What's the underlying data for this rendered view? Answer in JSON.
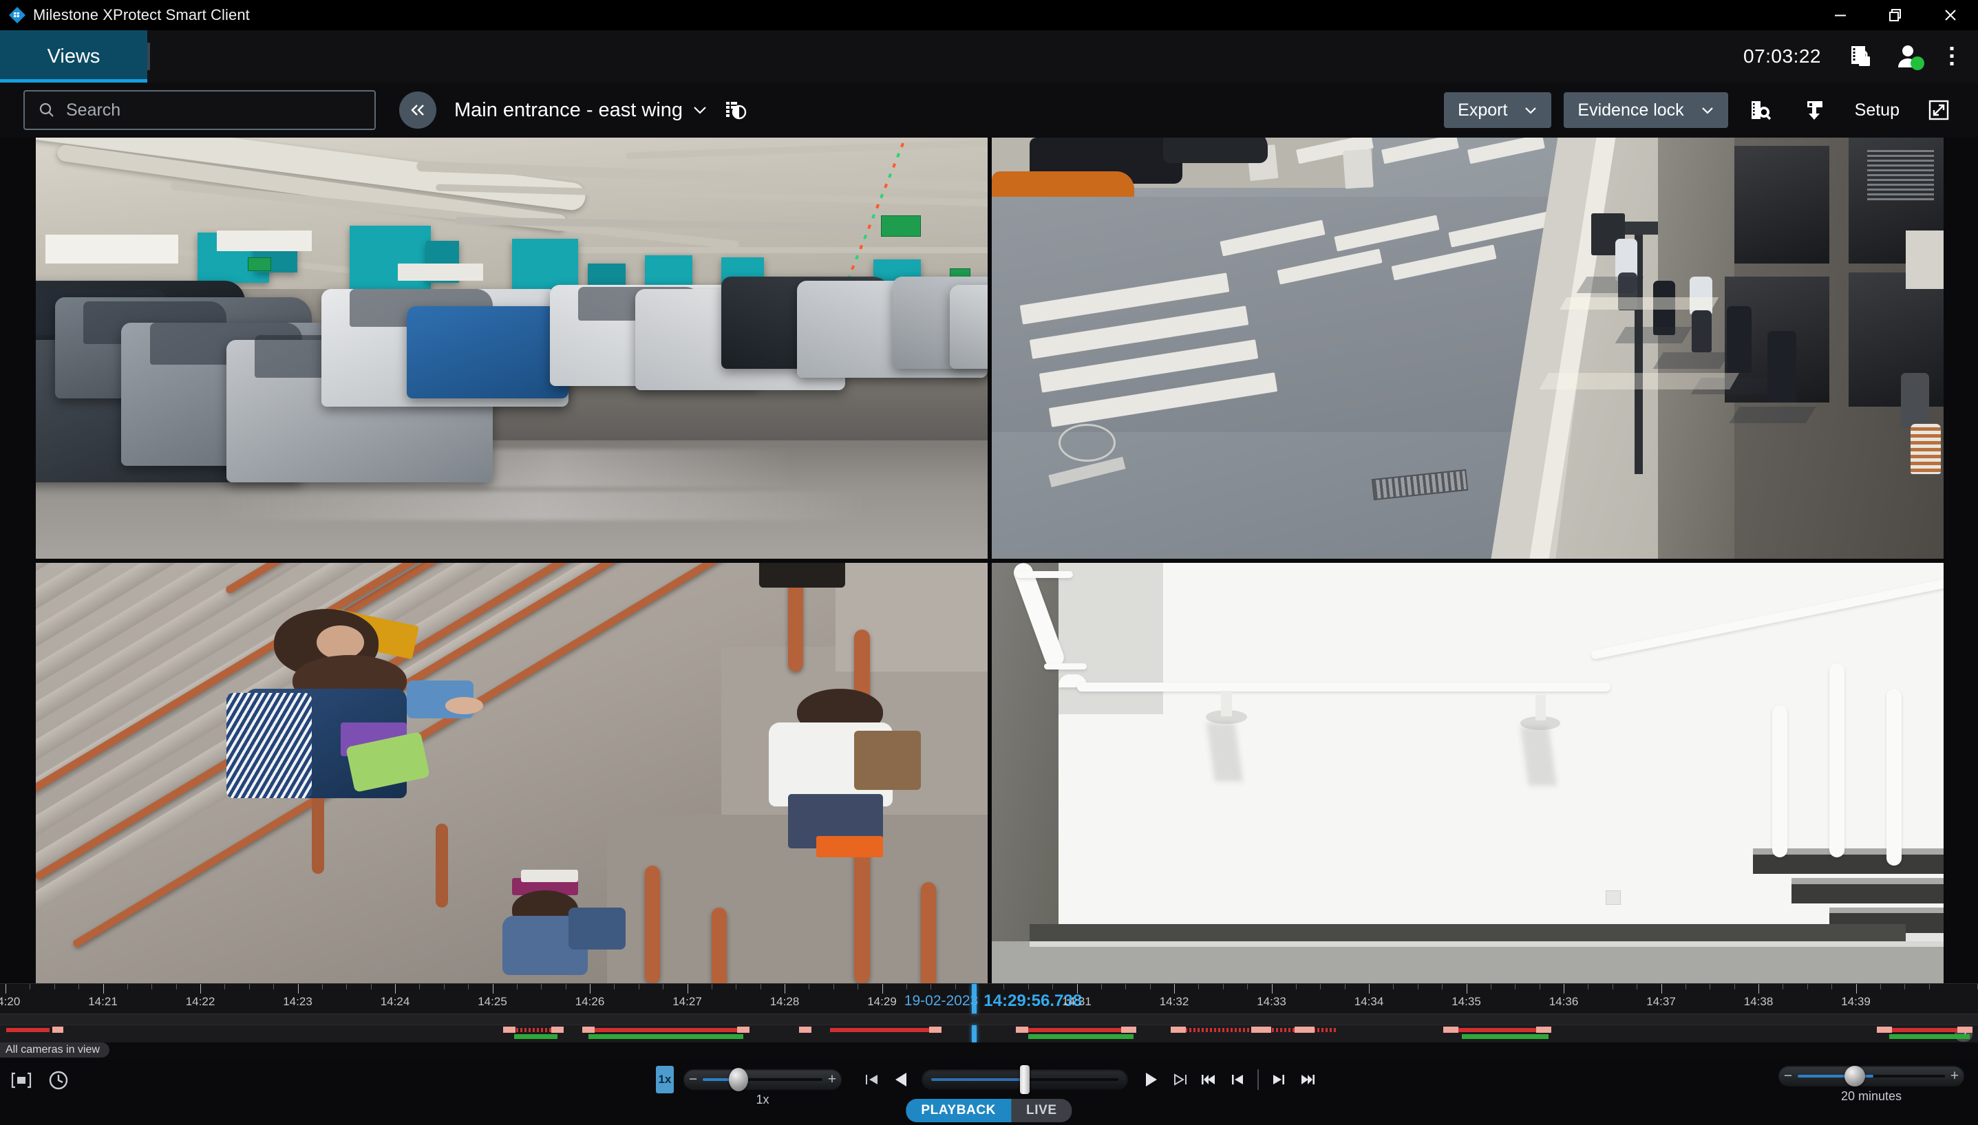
{
  "window": {
    "title": "Milestone XProtect Smart Client",
    "minimize_label": "Minimize",
    "restore_label": "Restore",
    "close_label": "Close"
  },
  "header": {
    "tab_label": "Views",
    "clock": "07:03:22",
    "evidence_lock_icon": "film-lock-icon",
    "user_icon": "user-avatar-icon",
    "user_status": "online",
    "status_color": "#22c03c",
    "menu_icon": "kebab-menu-icon"
  },
  "toolbar": {
    "search_placeholder": "Search",
    "search_value": "",
    "collapse_label": "«",
    "view_title": "Main entrance - east wing",
    "view_caret": "∨",
    "view_grid_icon": "view-layout-icon",
    "export_label": "Export",
    "export_caret": "∨",
    "evidence_lock_label": "Evidence lock",
    "evidence_lock_caret": "∨",
    "search_video_icon": "video-search-icon",
    "snapshot_icon": "download-snapshot-icon",
    "setup_label": "Setup",
    "fullscreen_icon": "fullscreen-expand-icon"
  },
  "grid": {
    "layout": "2x2",
    "panes": [
      {
        "name": "parking-garage-camera",
        "description": "Indoor parking garage with rows of parked cars and teal signage panels"
      },
      {
        "name": "street-crosswalk-camera",
        "description": "Street corner with crosswalk, cars and pedestrians on sidewalk"
      },
      {
        "name": "stairwell-people-camera",
        "description": "Overhead view of stairwell with copper railings and people walking"
      },
      {
        "name": "white-stairwell-camera",
        "description": "White stairwell with handrail and dark steps"
      }
    ]
  },
  "timeline": {
    "date": "19-02-2023",
    "current_time": "14:29:56.738",
    "camera_tab": "All cameras in view",
    "help_label": "?",
    "span_minutes": 20,
    "ticks": [
      "14:20",
      "14:21",
      "14:22",
      "14:23",
      "14:24",
      "14:25",
      "14:26",
      "14:27",
      "14:28",
      "14:29",
      "14:31",
      "14:32",
      "14:33",
      "14:34",
      "14:35",
      "14:36",
      "14:37",
      "14:38",
      "14:39"
    ],
    "playhead_percent": 50.0,
    "segments": [
      {
        "start": 0.5,
        "width": 3.5,
        "type": "recording"
      },
      {
        "start": 4.2,
        "width": 0.9,
        "type": "motion"
      },
      {
        "start": 41.0,
        "width": 4.0,
        "type": "recording"
      },
      {
        "start": 40.6,
        "width": 1.0,
        "type": "motion"
      },
      {
        "start": 44.5,
        "width": 1.0,
        "type": "motion"
      },
      {
        "start": 47.5,
        "width": 13.0,
        "type": "recording"
      },
      {
        "start": 47.0,
        "width": 1.0,
        "type": "motion"
      },
      {
        "start": 59.5,
        "width": 1.0,
        "type": "motion"
      },
      {
        "start": 64.5,
        "width": 1.0,
        "type": "motion"
      },
      {
        "start": 67.0,
        "width": 9.0,
        "type": "recording"
      },
      {
        "start": 75.0,
        "width": 1.0,
        "type": "motion"
      },
      {
        "start": 82.5,
        "width": 9.0,
        "type": "recording"
      },
      {
        "start": 82.0,
        "width": 1.0,
        "type": "motion"
      },
      {
        "start": 90.5,
        "width": 1.2,
        "type": "motion"
      },
      {
        "start": 95.0,
        "width": 13.0,
        "type": "recording"
      },
      {
        "start": 94.5,
        "width": 1.2,
        "type": "motion"
      },
      {
        "start": 101.0,
        "width": 1.6,
        "type": "motion"
      },
      {
        "start": 104.5,
        "width": 1.6,
        "type": "motion"
      },
      {
        "start": 117.0,
        "width": 8.0,
        "type": "recording"
      },
      {
        "start": 116.5,
        "width": 1.2,
        "type": "motion"
      },
      {
        "start": 124.0,
        "width": 1.2,
        "type": "motion"
      },
      {
        "start": 152.0,
        "width": 7.0,
        "type": "recording"
      },
      {
        "start": 151.5,
        "width": 1.2,
        "type": "motion"
      },
      {
        "start": 158.0,
        "width": 1.2,
        "type": "motion"
      }
    ],
    "audio_segments": [
      {
        "start": 41.5,
        "width": 3.5
      },
      {
        "start": 47.5,
        "width": 12.5
      },
      {
        "start": 83.0,
        "width": 8.5
      },
      {
        "start": 118.0,
        "width": 7.0
      },
      {
        "start": 152.5,
        "width": 6.5
      }
    ]
  },
  "controls": {
    "bookmark_icon": "bookmark-bracket-icon",
    "time_icon": "clock-icon",
    "speed_badge": "1x",
    "speed_label": "1x",
    "speed_minus": "−",
    "speed_plus": "+",
    "step_back_icon": "step-back-frame-icon",
    "play_reverse_icon": "play-reverse-icon",
    "jog_label": "jog-shuttle-slider",
    "play_icon": "play-icon",
    "step_forward_icon": "step-forward-frame-icon",
    "skip_start_icon": "skip-to-start-icon",
    "prev_seq_icon": "previous-sequence-icon",
    "next_seq_icon": "next-sequence-icon",
    "skip_end_icon": "skip-to-end-icon",
    "mode_playback": "PLAYBACK",
    "mode_live": "LIVE",
    "active_mode": "PLAYBACK",
    "zoom_minus": "−",
    "zoom_plus": "+",
    "zoom_label": "20 minutes"
  },
  "colors": {
    "accent_blue": "#14a0e0",
    "tab_bg": "#0c4a63",
    "button_bg": "#4b5864",
    "recording_red": "#d32f2f",
    "motion_pink": "#f0a79c",
    "audio_green": "#2fa83a",
    "playhead": "#3aa8ea",
    "online_green": "#22c03c"
  }
}
